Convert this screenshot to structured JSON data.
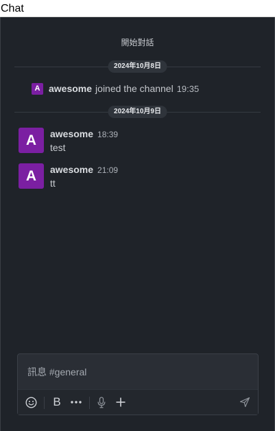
{
  "window": {
    "title": "Chat"
  },
  "chat": {
    "start_label": "開始對話",
    "dates": [
      "2024年10月8日",
      "2024年10月9日"
    ],
    "system_message": {
      "avatar_letter": "A",
      "user": "awesome",
      "text": "joined the channel",
      "time": "19:35"
    },
    "messages": [
      {
        "avatar_letter": "A",
        "user": "awesome",
        "time": "18:39",
        "text": "test"
      },
      {
        "avatar_letter": "A",
        "user": "awesome",
        "time": "21:09",
        "text": "tt"
      }
    ]
  },
  "composer": {
    "placeholder": "訊息 #general",
    "value": "",
    "tools": [
      "emoji-icon",
      "bold-icon",
      "more-icon",
      "microphone-icon",
      "plus-icon",
      "send-icon"
    ],
    "bold_label": "B"
  },
  "colors": {
    "background": "#1f2329",
    "avatar": "#7b1fa2",
    "date_pill": "#2f343b",
    "composer": "#2a2e35"
  }
}
